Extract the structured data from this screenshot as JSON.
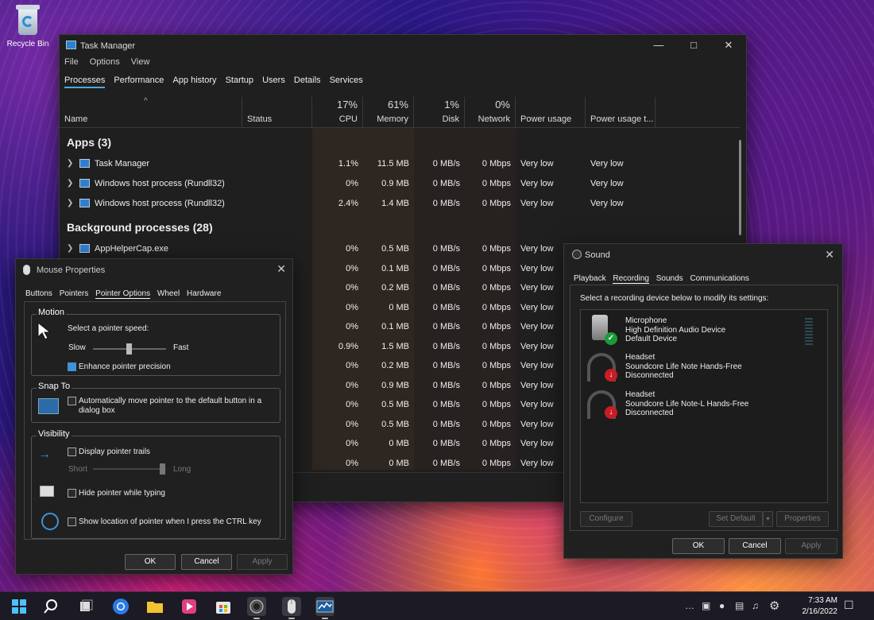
{
  "desktop": {
    "recycle_label": "Recycle Bin"
  },
  "task_manager": {
    "title": "Task Manager",
    "menu": [
      "File",
      "Options",
      "View"
    ],
    "tabs": [
      "Processes",
      "Performance",
      "App history",
      "Startup",
      "Users",
      "Details",
      "Services"
    ],
    "columns": {
      "name": "Name",
      "status": "Status",
      "cpu_pct": "17%",
      "cpu": "CPU",
      "mem_pct": "61%",
      "mem": "Memory",
      "disk_pct": "1%",
      "disk": "Disk",
      "net_pct": "0%",
      "net": "Network",
      "power": "Power usage",
      "power_trend": "Power usage t..."
    },
    "apps_group": "Apps (3)",
    "apps": [
      {
        "name": "Task Manager",
        "cpu": "1.1%",
        "mem": "11.5 MB",
        "disk": "0 MB/s",
        "net": "0 Mbps",
        "power": "Very low",
        "trend": "Very low"
      },
      {
        "name": "Windows host process (Rundll32)",
        "cpu": "0%",
        "mem": "0.9 MB",
        "disk": "0 MB/s",
        "net": "0 Mbps",
        "power": "Very low",
        "trend": "Very low"
      },
      {
        "name": "Windows host process (Rundll32)",
        "cpu": "2.4%",
        "mem": "1.4 MB",
        "disk": "0 MB/s",
        "net": "0 Mbps",
        "power": "Very low",
        "trend": "Very low"
      }
    ],
    "bg_group": "Background processes (28)",
    "bg": [
      {
        "name": "AppHelperCap.exe",
        "cpu": "0%",
        "mem": "0.5 MB",
        "disk": "0 MB/s",
        "net": "0 Mbps",
        "power": "Very low"
      },
      {
        "cpu": "0%",
        "mem": "0.1 MB",
        "disk": "0 MB/s",
        "net": "0 Mbps",
        "power": "Very low"
      },
      {
        "cpu": "0%",
        "mem": "0.2 MB",
        "disk": "0 MB/s",
        "net": "0 Mbps",
        "power": "Very low"
      },
      {
        "cpu": "0%",
        "mem": "0 MB",
        "disk": "0 MB/s",
        "net": "0 Mbps",
        "power": "Very low"
      },
      {
        "cpu": "0%",
        "mem": "0.1 MB",
        "disk": "0 MB/s",
        "net": "0 Mbps",
        "power": "Very low"
      },
      {
        "cpu": "0.9%",
        "mem": "1.5 MB",
        "disk": "0 MB/s",
        "net": "0 Mbps",
        "power": "Very low"
      },
      {
        "cpu": "0%",
        "mem": "0.2 MB",
        "disk": "0 MB/s",
        "net": "0 Mbps",
        "power": "Very low"
      },
      {
        "cpu": "0%",
        "mem": "0.9 MB",
        "disk": "0 MB/s",
        "net": "0 Mbps",
        "power": "Very low"
      },
      {
        "cpu": "0%",
        "mem": "0.5 MB",
        "disk": "0 MB/s",
        "net": "0 Mbps",
        "power": "Very low"
      },
      {
        "cpu": "0%",
        "mem": "0.5 MB",
        "disk": "0 MB/s",
        "net": "0 Mbps",
        "power": "Very low"
      },
      {
        "cpu": "0%",
        "mem": "0 MB",
        "disk": "0 MB/s",
        "net": "0 Mbps",
        "power": "Very low"
      },
      {
        "cpu": "0%",
        "mem": "0 MB",
        "disk": "0 MB/s",
        "net": "0 Mbps",
        "power": "Very low"
      }
    ]
  },
  "mouse": {
    "title": "Mouse Properties",
    "tabs": [
      "Buttons",
      "Pointers",
      "Pointer Options",
      "Wheel",
      "Hardware"
    ],
    "motion": "Motion",
    "speed_label": "Select a pointer speed:",
    "slow": "Slow",
    "fast": "Fast",
    "precision": "Enhance pointer precision",
    "snap": "Snap To",
    "snap_text1": "Automatically move pointer to the default button in a",
    "snap_text2": "dialog box",
    "visibility": "Visibility",
    "trails": "Display pointer trails",
    "short": "Short",
    "long": "Long",
    "hide": "Hide pointer while typing",
    "ctrl": "Show location of pointer when I press the CTRL key",
    "ok": "OK",
    "cancel": "Cancel",
    "apply": "Apply"
  },
  "sound": {
    "title": "Sound",
    "tabs": [
      "Playback",
      "Recording",
      "Sounds",
      "Communications"
    ],
    "instruction": "Select a recording device below to modify its settings:",
    "devices": [
      {
        "name": "Microphone",
        "desc": "High Definition Audio Device",
        "state": "Default Device"
      },
      {
        "name": "Headset",
        "desc": "Soundcore Life Note Hands-Free",
        "state": "Disconnected"
      },
      {
        "name": "Headset",
        "desc": "Soundcore Life Note-L Hands-Free",
        "state": "Disconnected"
      }
    ],
    "configure": "Configure",
    "set_default": "Set Default",
    "properties": "Properties",
    "ok": "OK",
    "cancel": "Cancel",
    "apply": "Apply"
  },
  "taskbar": {
    "time": "7:33 AM",
    "date": "2/16/2022"
  }
}
